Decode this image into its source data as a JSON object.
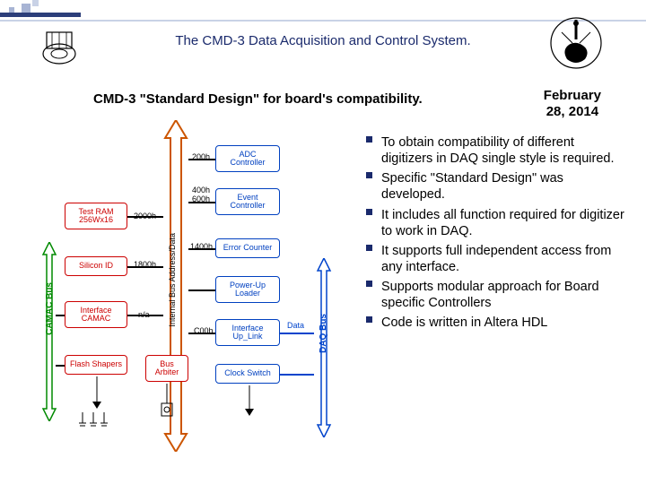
{
  "title": "The CMD-3 Data Acquisition and Control System.",
  "subtitle": "CMD-3 \"Standard Design\" for board's compatibility.",
  "date": "February\n28, 2014",
  "bullets": [
    "To obtain compatibility of different digitizers in DAQ single style is required.",
    "Specific \"Standard Design\" was developed.",
    "It includes all function required for digitizer to work in DAQ.",
    "It supports full independent access from any interface.",
    "Supports modular approach for Board specific Controllers",
    "Code is written in Altera HDL"
  ],
  "diagram": {
    "vLabels": {
      "camac": "CAMAC Bus",
      "internal": "Internal Bus Address/Data",
      "daq": "DAQ Bus"
    },
    "dataLabel": "Data",
    "leftBlocks": [
      {
        "label": "Test RAM\n256Wx16",
        "addr": "2000h"
      },
      {
        "label": "Silicon ID",
        "addr": "1800h"
      },
      {
        "label": "Interface\nCAMAC",
        "addr": "n/a"
      },
      {
        "label": "Flash Shapers",
        "addr": ""
      }
    ],
    "rightBlocks": [
      {
        "label": "ADC\nController",
        "addr": "200h"
      },
      {
        "label": "Event\nController",
        "addr": "400h\n600h"
      },
      {
        "label": "Error Counter",
        "addr": "1400h"
      },
      {
        "label": "Power-Up\nLoader",
        "addr": ""
      },
      {
        "label": "Interface\nUp_Link",
        "addr": "C00h"
      },
      {
        "label": "Clock Switch",
        "addr": ""
      }
    ],
    "busArbiter": "Bus\nArbiter"
  }
}
